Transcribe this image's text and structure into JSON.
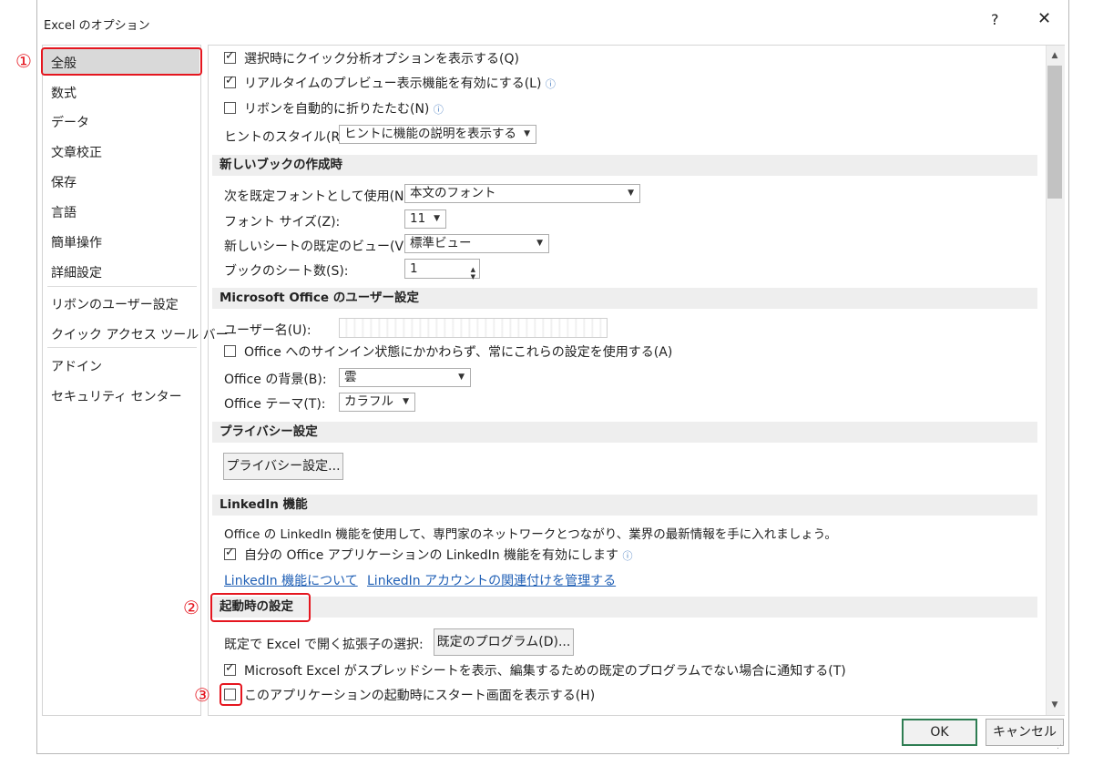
{
  "window": {
    "title": "Excel のオプション",
    "help": "?",
    "close": "✕"
  },
  "sidebar": {
    "items": [
      {
        "label": "全般"
      },
      {
        "label": "数式"
      },
      {
        "label": "データ"
      },
      {
        "label": "文章校正"
      },
      {
        "label": "保存"
      },
      {
        "label": "言語"
      },
      {
        "label": "簡単操作"
      },
      {
        "label": "詳細設定"
      },
      {
        "label": "リボンのユーザー設定"
      },
      {
        "label": "クイック アクセス ツール バー"
      },
      {
        "label": "アドイン"
      },
      {
        "label": "セキュリティ センター"
      }
    ],
    "selected": "全般"
  },
  "ui_options": {
    "quick_analysis": {
      "label": "選択時にクイック分析オプションを表示する(Q)",
      "checked": true
    },
    "live_preview": {
      "label": "リアルタイムのプレビュー表示機能を有効にする(L)",
      "checked": true
    },
    "collapse_ribbon": {
      "label": "リボンを自動的に折りたたむ(N)",
      "checked": false
    },
    "tip_style": {
      "label": "ヒントのスタイル(R):",
      "value": "ヒントに機能の説明を表示する"
    }
  },
  "new_workbook": {
    "header": "新しいブックの作成時",
    "font": {
      "label": "次を既定フォントとして使用(N):",
      "value": "本文のフォント"
    },
    "font_size": {
      "label": "フォント サイズ(Z):",
      "value": "11"
    },
    "default_view": {
      "label": "新しいシートの既定のビュー(V):",
      "value": "標準ビュー"
    },
    "sheet_count": {
      "label": "ブックのシート数(S):",
      "value": "1"
    }
  },
  "user_settings": {
    "header": "Microsoft Office のユーザー設定",
    "username_label": "ユーザー名(U):",
    "always_use": {
      "label": "Office へのサインイン状態にかかわらず、常にこれらの設定を使用する(A)",
      "checked": false
    },
    "background": {
      "label": "Office の背景(B):",
      "value": "雲"
    },
    "theme": {
      "label": "Office テーマ(T):",
      "value": "カラフル"
    }
  },
  "privacy": {
    "header": "プライバシー設定",
    "button": "プライバシー設定..."
  },
  "linkedin": {
    "header": "LinkedIn 機能",
    "description": "Office の LinkedIn 機能を使用して、専門家のネットワークとつながり、業界の最新情報を手に入れましょう。",
    "enable": {
      "label": "自分の Office アプリケーションの LinkedIn 機能を有効にします",
      "checked": true
    },
    "link_about": "LinkedIn 機能について",
    "link_manage": "LinkedIn アカウントの関連付けを管理する"
  },
  "startup": {
    "header": "起動時の設定",
    "default_ext_label": "既定で Excel で開く拡張子の選択:",
    "default_programs_button": "既定のプログラム(D)...",
    "notify_default": {
      "label": "Microsoft Excel がスプレッドシートを表示、編集するための既定のプログラムでない場合に通知する(T)",
      "checked": true
    },
    "show_start_screen": {
      "label": "このアプリケーションの起動時にスタート画面を表示する(H)",
      "checked": false
    }
  },
  "footer": {
    "ok": "OK",
    "cancel": "キャンセル"
  },
  "annotations": {
    "marker1": "①",
    "marker2": "②",
    "marker3": "③",
    "color": "#e5161f"
  },
  "icons": {
    "info": "ⓘ",
    "dropdown": "▼",
    "spin_up": "▲",
    "spin_down": "▼"
  }
}
